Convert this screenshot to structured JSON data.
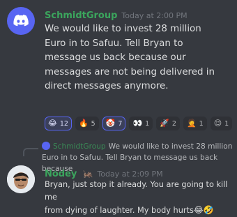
{
  "message1": {
    "author": "SchmidtGroup",
    "timestamp": "Today at 2:00 PM",
    "lines": [
      "We would like to invest 28 million",
      "Euro in to Safuu. Tell Bryan to",
      "message us back because our",
      "messages are not being delivered in",
      "direct messages anymore."
    ],
    "reactions": [
      {
        "icon": "joy-emoji",
        "glyph": "😂",
        "count": "12",
        "active": true
      },
      {
        "icon": "fire-emoji",
        "glyph": "🔥",
        "count": "5",
        "active": false
      },
      {
        "icon": "clown-emoji",
        "glyph": "🤡",
        "count": "7",
        "active": true
      },
      {
        "icon": "eyes-emoji",
        "glyph": "👀",
        "count": "1",
        "active": false
      },
      {
        "icon": "rocket-emoji",
        "glyph": "🚀",
        "count": "2",
        "active": false
      },
      {
        "icon": "facepalm-emoji",
        "glyph": "🤦",
        "count": "1",
        "active": false
      },
      {
        "icon": "relieved-emoji",
        "glyph": "😌",
        "count": "1",
        "active": false
      }
    ]
  },
  "reply_preview": {
    "author": "SchmidtGroup",
    "text": "We would like to invest 28 million",
    "text_line2": "Euro in to Safuu. Tell Bryan to message us back because"
  },
  "message2": {
    "author": "Nodey",
    "badge_icon": "cricket-emoji",
    "timestamp": "Today at 2:09 PM",
    "line1": "Bryan, just stop it already. You are going to kill me",
    "line2": "from dying of laughter. My body hurts",
    "trailing_emojis": "😂🤣"
  },
  "colors": {
    "background": "#36393f",
    "accent": "#5865f2",
    "username_green": "#3ba55d"
  }
}
